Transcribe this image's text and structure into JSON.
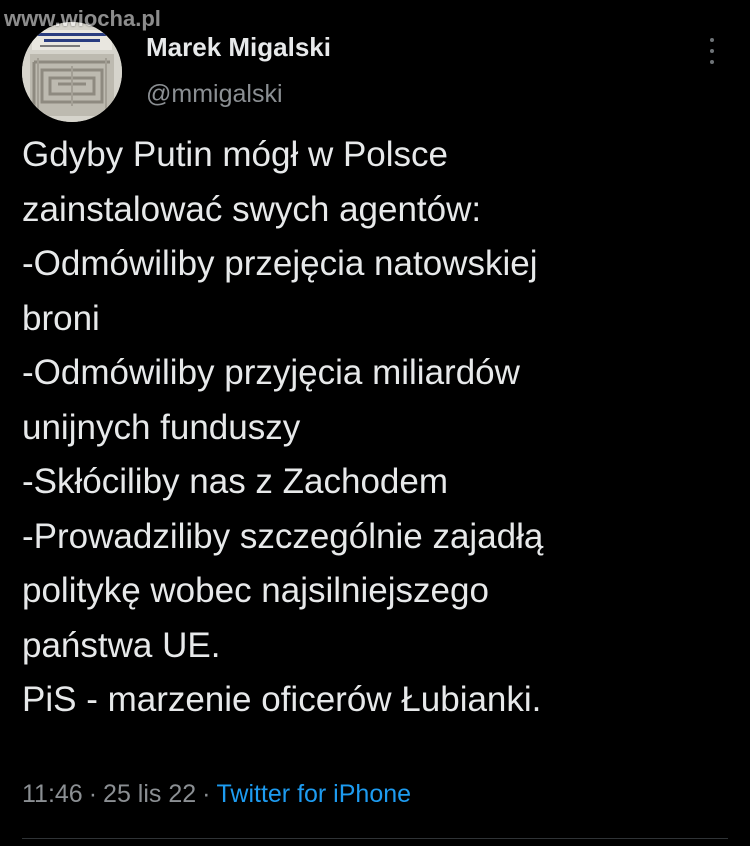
{
  "watermark": {
    "text": "www.wiocha.pl"
  },
  "author": {
    "display_name": "Marek Migalski",
    "handle": "@mmigalski",
    "avatar_icon": "book-cover-avatar"
  },
  "more_icon": "vertical-ellipsis-icon",
  "tweet": {
    "lines": [
      "Gdyby Putin mógł w Polsce",
      "zainstalować swych agentów:",
      "-Odmówiliby przejęcia natowskiej",
      "broni",
      "-Odmówiliby przyjęcia miliardów",
      "unijnych funduszy",
      "-Skłóciliby nas z Zachodem",
      "-Prowadziliby szczególnie zajadłą",
      "politykę wobec najsilniejszego",
      "państwa UE.",
      "PiS - marzenie oficerów Łubianki."
    ]
  },
  "meta": {
    "time": "11:46",
    "separator": "·",
    "date": "25 lis 22",
    "source": "Twitter for iPhone"
  },
  "colors": {
    "background": "#000000",
    "text": "#e7e9ea",
    "secondary": "#8b8f93",
    "link": "#1d9bf0"
  }
}
